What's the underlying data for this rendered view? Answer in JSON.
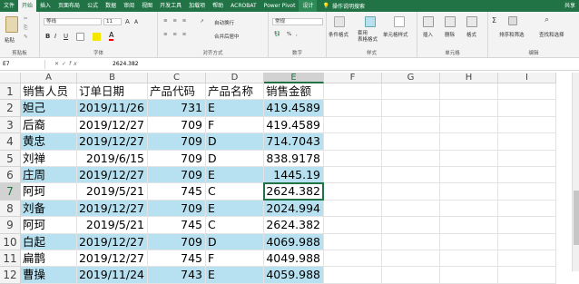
{
  "tabs": [
    "文件",
    "开始",
    "插入",
    "页面布局",
    "公式",
    "数据",
    "审阅",
    "视图",
    "开发工具",
    "加载项",
    "帮助",
    "ACROBAT",
    "Power Pivot",
    "设计"
  ],
  "active_tab": "开始",
  "tell_me": "操作说明搜索",
  "share": "共享",
  "ribbon": {
    "clipboard": {
      "label": "剪贴板",
      "paste": "粘贴"
    },
    "font": {
      "label": "字体",
      "font_name": "等线",
      "font_size": "11",
      "bold": "B",
      "italic": "I",
      "underline": "U",
      "font_color": "A",
      "grow": "A",
      "shrink": "A"
    },
    "alignment": {
      "label": "对齐方式",
      "wrap": "自动换行",
      "merge": "合并后居中"
    },
    "number": {
      "label": "数字",
      "format": "常规",
      "percent": "%",
      "comma": ","
    },
    "styles": {
      "label": "样式",
      "cond": "条件格式",
      "table": "套用\n表格格式",
      "cell_styles": "单元格样式"
    },
    "cells": {
      "label": "单元格",
      "insert": "插入",
      "delete": "删除",
      "format": "格式"
    },
    "editing": {
      "label": "编辑",
      "sort": "排序和筛选",
      "find": "查找和选择"
    }
  },
  "formula_bar": {
    "name_box": "E7",
    "fx": "fx",
    "value": "2624.382"
  },
  "columns": [
    "A",
    "B",
    "C",
    "D",
    "E",
    "F",
    "G",
    "H",
    "I"
  ],
  "selected_column": "E",
  "selected_row": 7,
  "rows": [
    {
      "n": "1",
      "a": "销售人员",
      "b": "订单日期",
      "c": "产品代码",
      "d": "产品名称",
      "e": "销售金额",
      "blue": false,
      "header": true
    },
    {
      "n": "2",
      "a": "妲己",
      "b": "2019/11/26",
      "c": "731",
      "d": "E",
      "e": "419.4589",
      "blue": true
    },
    {
      "n": "3",
      "a": "后裔",
      "b": "2019/12/27",
      "c": "709",
      "d": "F",
      "e": "419.4589",
      "blue": false
    },
    {
      "n": "4",
      "a": "黄忠",
      "b": "2019/12/27",
      "c": "709",
      "d": "D",
      "e": "714.7043",
      "blue": true
    },
    {
      "n": "5",
      "a": "刘禅",
      "b": "2019/6/15",
      "c": "709",
      "d": "D",
      "e": "838.9178",
      "blue": false
    },
    {
      "n": "6",
      "a": "庄周",
      "b": "2019/12/27",
      "c": "709",
      "d": "E",
      "e": "1445.19",
      "blue": true
    },
    {
      "n": "7",
      "a": "阿珂",
      "b": "2019/5/21",
      "c": "745",
      "d": "C",
      "e": "2624.382",
      "blue": false
    },
    {
      "n": "8",
      "a": "刘备",
      "b": "2019/12/27",
      "c": "709",
      "d": "E",
      "e": "2024.994",
      "blue": true
    },
    {
      "n": "9",
      "a": "阿珂",
      "b": "2019/5/21",
      "c": "745",
      "d": "C",
      "e": "2624.382",
      "blue": false
    },
    {
      "n": "10",
      "a": "白起",
      "b": "2019/12/27",
      "c": "709",
      "d": "D",
      "e": "4069.988",
      "blue": true
    },
    {
      "n": "11",
      "a": "扁鹊",
      "b": "2019/12/27",
      "c": "745",
      "d": "F",
      "e": "4049.988",
      "blue": false
    },
    {
      "n": "12",
      "a": "曹操",
      "b": "2019/11/24",
      "c": "743",
      "d": "E",
      "e": "4059.988",
      "blue": true
    }
  ],
  "colors": {
    "excel_green": "#217346",
    "band_blue": "#b7e1f0"
  }
}
